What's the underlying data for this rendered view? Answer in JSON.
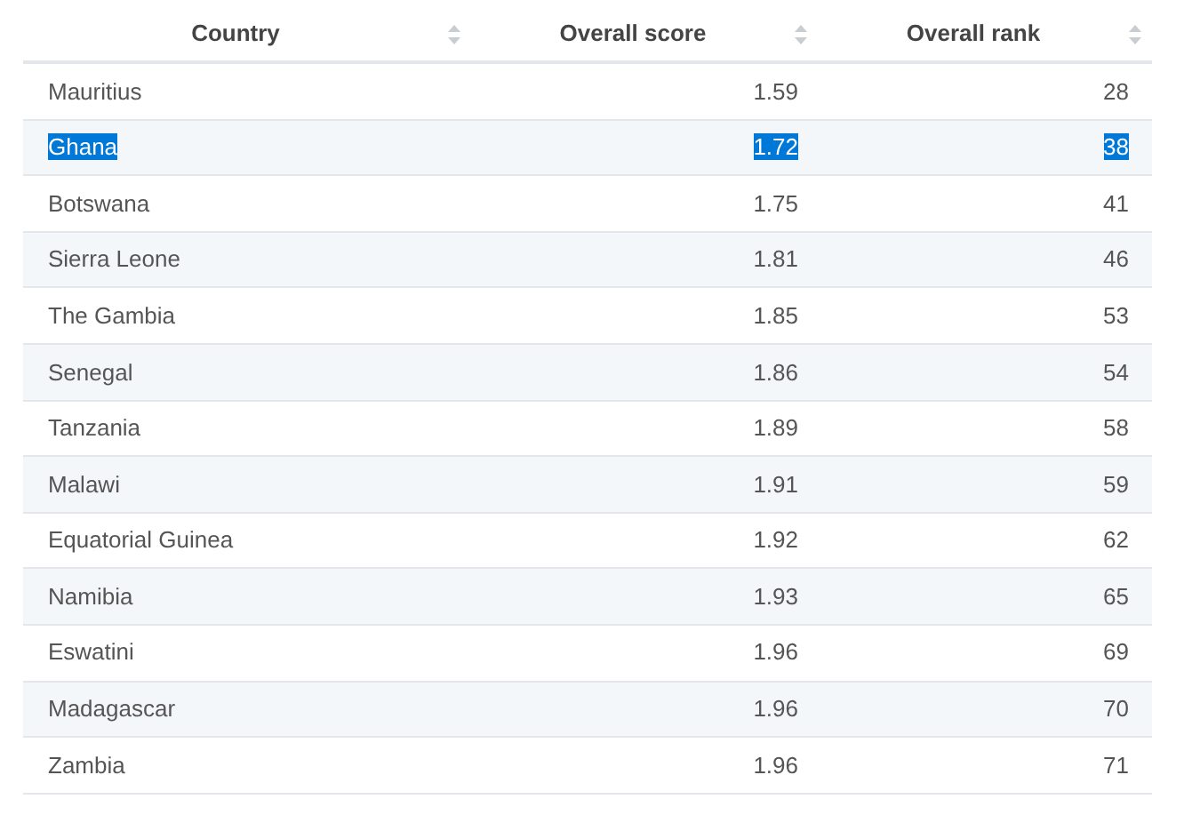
{
  "table": {
    "columns": [
      "Country",
      "Overall score",
      "Overall rank"
    ],
    "rows": [
      {
        "cells": [
          "Mauritius",
          "1.59",
          "28"
        ],
        "highlighted": false
      },
      {
        "cells": [
          "Ghana",
          "1.72",
          "38"
        ],
        "highlighted": true
      },
      {
        "cells": [
          "Botswana",
          "1.75",
          "41"
        ],
        "highlighted": false
      },
      {
        "cells": [
          "Sierra Leone",
          "1.81",
          "46"
        ],
        "highlighted": false
      },
      {
        "cells": [
          "The Gambia",
          "1.85",
          "53"
        ],
        "highlighted": false
      },
      {
        "cells": [
          "Senegal",
          "1.86",
          "54"
        ],
        "highlighted": false
      },
      {
        "cells": [
          "Tanzania",
          "1.89",
          "58"
        ],
        "highlighted": false
      },
      {
        "cells": [
          "Malawi",
          "1.91",
          "59"
        ],
        "highlighted": false
      },
      {
        "cells": [
          "Equatorial Guinea",
          "1.92",
          "62"
        ],
        "highlighted": false
      },
      {
        "cells": [
          "Namibia",
          "1.93",
          "65"
        ],
        "highlighted": false
      },
      {
        "cells": [
          "Eswatini",
          "1.96",
          "69"
        ],
        "highlighted": false
      },
      {
        "cells": [
          "Madagascar",
          "1.96",
          "70"
        ],
        "highlighted": false
      },
      {
        "cells": [
          "Zambia",
          "1.96",
          "71"
        ],
        "highlighted": false
      }
    ]
  }
}
